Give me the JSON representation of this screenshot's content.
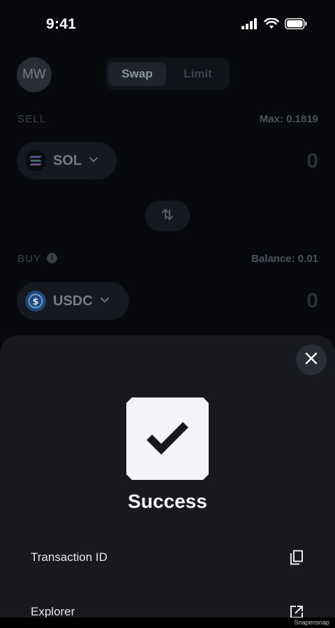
{
  "status_bar": {
    "time": "9:41"
  },
  "header": {
    "avatar_initials": "MW",
    "tabs": [
      {
        "label": "Swap",
        "active": true
      },
      {
        "label": "Limit",
        "active": false
      }
    ]
  },
  "sell": {
    "label": "SELL",
    "max_text": "Max: 0.1819",
    "token": "SOL",
    "amount": "0"
  },
  "buy": {
    "label": "BUY",
    "info_glyph": "i",
    "balance_text": "Balance: 0.01",
    "token": "USDC",
    "amount": "0"
  },
  "sheet": {
    "title": "Success",
    "rows": [
      {
        "label": "Transaction ID",
        "icon": "copy-icon"
      },
      {
        "label": "Explorer",
        "icon": "external-link-icon"
      }
    ]
  },
  "watermark": "Snapensnap",
  "colors": {
    "background": "#07090c",
    "sheet": "#17191e",
    "badge": "#f3f4f7",
    "usdc_blue": "#2775ca"
  }
}
